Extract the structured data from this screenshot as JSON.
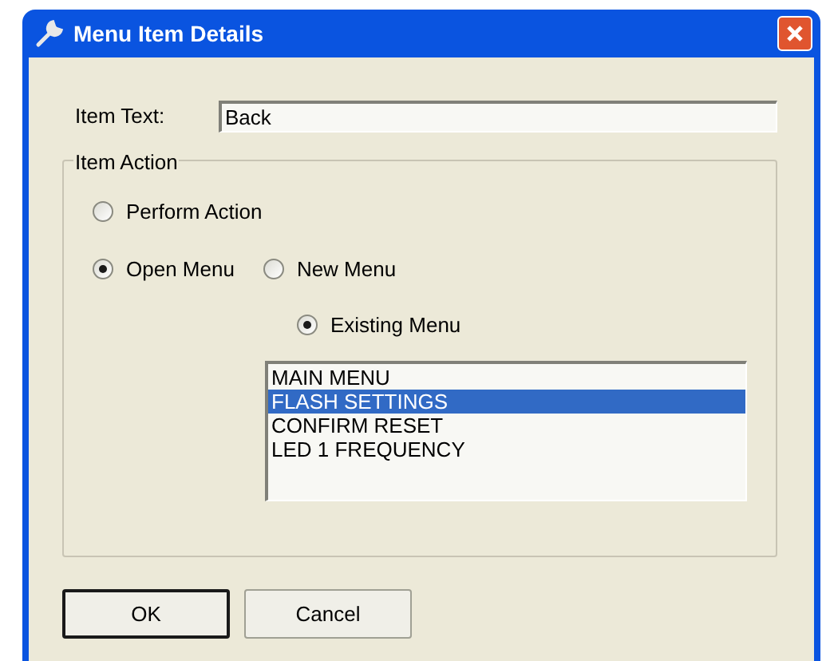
{
  "window": {
    "title": "Menu Item Details"
  },
  "item_text": {
    "label": "Item Text:",
    "value": "Back"
  },
  "item_action": {
    "title": "Item Action",
    "perform_action": {
      "label": "Perform Action",
      "selected": false
    },
    "open_menu": {
      "label": "Open Menu",
      "selected": true
    },
    "new_menu": {
      "label": "New Menu",
      "selected": false
    },
    "existing_menu": {
      "label": "Existing Menu",
      "selected": true
    },
    "menus": [
      {
        "label": "MAIN MENU",
        "selected": false
      },
      {
        "label": "FLASH SETTINGS",
        "selected": true
      },
      {
        "label": "CONFIRM RESET",
        "selected": false
      },
      {
        "label": "LED 1 FREQUENCY",
        "selected": false
      }
    ]
  },
  "buttons": [
    {
      "label": "OK",
      "default": true
    },
    {
      "label": "Cancel",
      "default": false
    }
  ]
}
